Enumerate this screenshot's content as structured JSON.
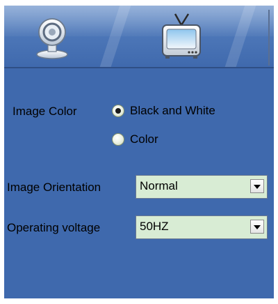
{
  "toolbar": {
    "tabs": [
      {
        "icon": "webcam-icon"
      },
      {
        "icon": "tv-icon"
      }
    ]
  },
  "settings": {
    "image_color": {
      "label": "Image Color",
      "options": [
        "Black and White",
        "Color"
      ],
      "selected": "Black and White"
    },
    "image_orientation": {
      "label": "Image Orientation",
      "value": "Normal"
    },
    "operating_voltage": {
      "label": "Operating voltage",
      "value": "50HZ"
    }
  },
  "colors": {
    "panel": "#3f69ad",
    "field": "#d8ecd4"
  }
}
